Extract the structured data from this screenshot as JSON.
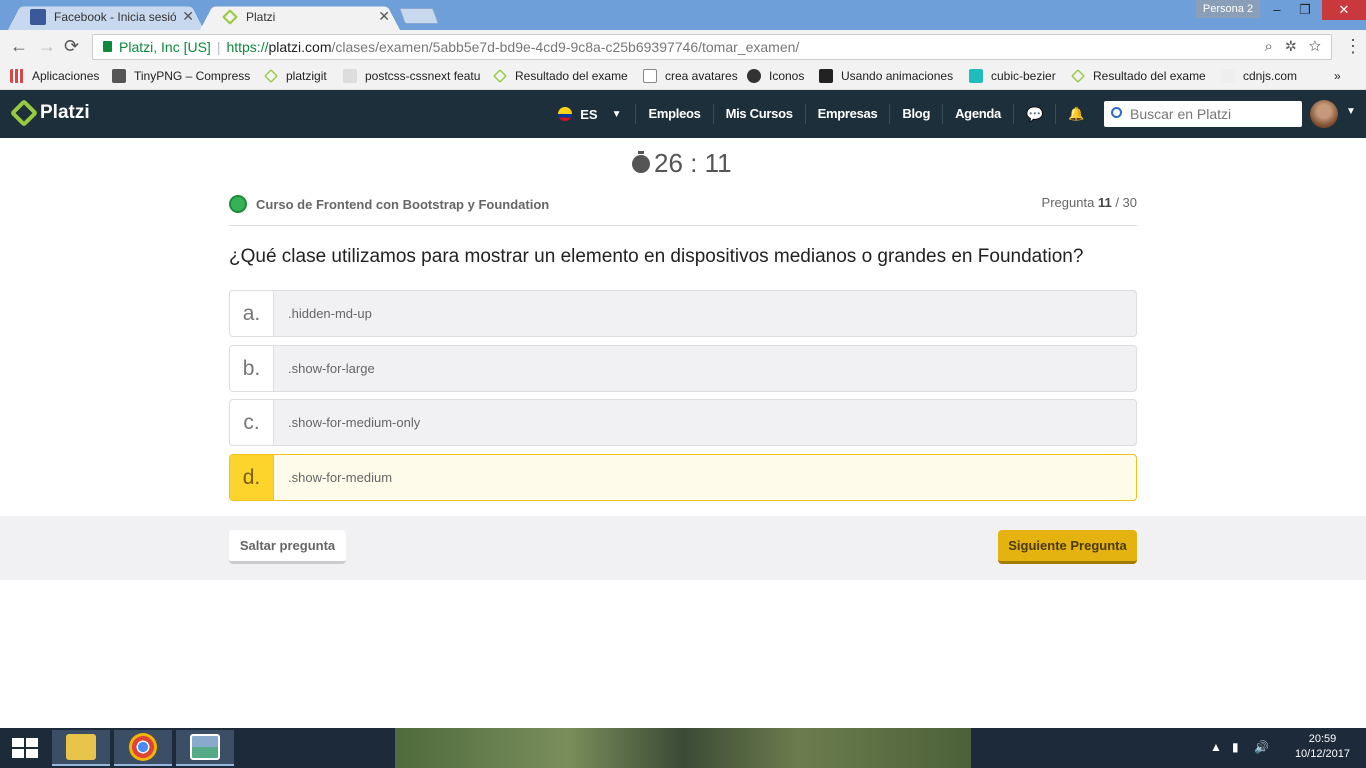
{
  "browser": {
    "tabs": [
      {
        "title": "Facebook - Inicia sesión o",
        "close": "✕"
      },
      {
        "title": "Platzi",
        "close": "✕"
      }
    ],
    "profile": "Persona 2",
    "window_controls": {
      "minimize": "–",
      "restore": "❐",
      "close": "✕"
    },
    "address": {
      "site_identity": "Platzi, Inc [US]",
      "scheme": "https://",
      "host": "platzi.com",
      "path": "/clases/examen/5abb5e7d-bd9e-4cd9-9c8a-c25b69397746/tomar_examen/"
    },
    "bookmarks": [
      {
        "label": "Aplicaciones",
        "color": "#d94"
      },
      {
        "label": "TinyPNG – Compress",
        "color": "#444"
      },
      {
        "label": "platzigit",
        "color": "#98ca3f"
      },
      {
        "label": "postcss-cssnext featu",
        "color": "#ccc"
      },
      {
        "label": "Resultado del exame",
        "color": "#98ca3f"
      },
      {
        "label": "crea avatares",
        "color": "#999"
      },
      {
        "label": "Iconos",
        "color": "#333"
      },
      {
        "label": "Usando animaciones",
        "color": "#222"
      },
      {
        "label": "cubic-bezier",
        "color": "#2bb"
      },
      {
        "label": "Resultado del exame",
        "color": "#98ca3f"
      },
      {
        "label": "cdnjs.com",
        "color": "#eee"
      }
    ],
    "bookmarks_more": "»"
  },
  "navbar": {
    "brand": "Platzi",
    "language": "ES",
    "links": [
      "Empleos",
      "Mis Cursos",
      "Empresas",
      "Blog",
      "Agenda"
    ],
    "search_placeholder": "Buscar en Platzi"
  },
  "exam": {
    "timer": "26 : 11",
    "course": "Curso de Frontend con Bootstrap y Foundation",
    "question_label": "Pregunta",
    "question_current": "11",
    "question_total": "/ 30",
    "question": "¿Qué clase utilizamos para mostrar un elemento en dispositivos medianos o grandes en Foundation?",
    "options": [
      {
        "letter": "a.",
        "text": ".hidden-md-up",
        "selected": false
      },
      {
        "letter": "b.",
        "text": ".show-for-large",
        "selected": false
      },
      {
        "letter": "c.",
        "text": ".show-for-medium-only",
        "selected": false
      },
      {
        "letter": "d.",
        "text": ".show-for-medium",
        "selected": true
      }
    ],
    "skip_label": "Saltar pregunta",
    "next_label": "Siguiente Pregunta"
  },
  "taskbar": {
    "time": "20:59",
    "date": "10/12/2017"
  },
  "colors": {
    "navbar_bg": "#1d2f3a",
    "brand_green": "#98ca3f",
    "selected_yellow": "#fcd42b",
    "next_button": "#e5b30f"
  }
}
